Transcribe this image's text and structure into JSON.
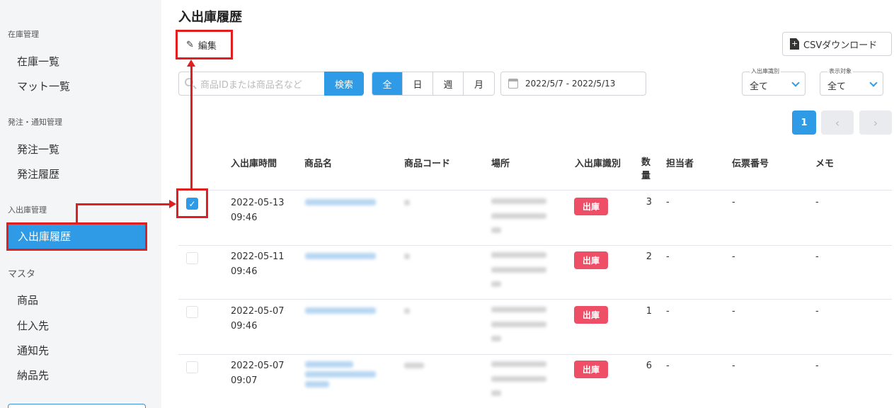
{
  "page": {
    "title": "入出庫履歴"
  },
  "sidebar": {
    "groups": [
      {
        "label": "在庫管理",
        "items": [
          "在庫一覧",
          "マット一覧"
        ]
      },
      {
        "label": "発注・通知管理",
        "items": [
          "発注一覧",
          "発注履歴"
        ]
      },
      {
        "label": "入出庫管理",
        "items": [
          "入出庫履歴"
        ]
      },
      {
        "label": "マスタ",
        "items": [
          "商品",
          "仕入先",
          "通知先",
          "納品先"
        ]
      }
    ],
    "active_item": "入出庫履歴"
  },
  "toolbar": {
    "edit_label": "編集",
    "csv_label": "CSVダウンロード",
    "search_placeholder": "商品IDまたは商品名など",
    "search_button": "検索",
    "period_tabs": [
      "全",
      "日",
      "週",
      "月"
    ],
    "active_period": "全",
    "date_range": "2022/5/7 - 2022/5/13",
    "filters": [
      {
        "label": "入出庫識別",
        "value": "全て"
      },
      {
        "label": "表示対象",
        "value": "全て"
      }
    ]
  },
  "pagination": {
    "current": "1",
    "prev": "‹",
    "next": "›"
  },
  "table": {
    "headers": [
      "入出庫時間",
      "商品名",
      "商品コード",
      "場所",
      "入出庫識別",
      "数量",
      "担当者",
      "伝票番号",
      "メモ"
    ],
    "rows": [
      {
        "checked": true,
        "date": "2022-05-13",
        "time": "09:46",
        "type": "出庫",
        "qty": "3",
        "staff": "-",
        "slip": "-",
        "memo": "-"
      },
      {
        "checked": false,
        "date": "2022-05-11",
        "time": "09:46",
        "type": "出庫",
        "qty": "2",
        "staff": "-",
        "slip": "-",
        "memo": "-"
      },
      {
        "checked": false,
        "date": "2022-05-07",
        "time": "09:46",
        "type": "出庫",
        "qty": "1",
        "staff": "-",
        "slip": "-",
        "memo": "-"
      },
      {
        "checked": false,
        "date": "2022-05-07",
        "time": "09:07",
        "type": "出庫",
        "qty": "6",
        "staff": "-",
        "slip": "-",
        "memo": "-"
      }
    ]
  },
  "colors": {
    "accent": "#2f9be6",
    "badge": "#ee4f66",
    "annotation": "#e02020"
  }
}
